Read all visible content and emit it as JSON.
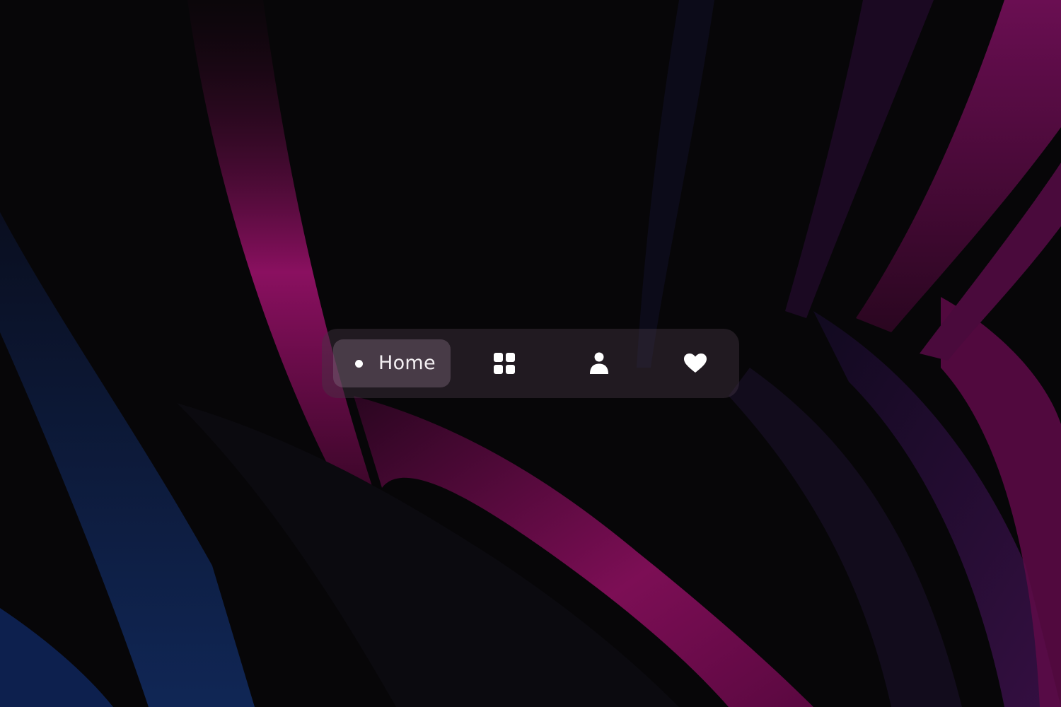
{
  "nav": {
    "home_label": "Home",
    "items": [
      {
        "id": "home",
        "icon": "dot-icon",
        "label": "Home",
        "active": true
      },
      {
        "id": "apps",
        "icon": "grid-icon",
        "active": false
      },
      {
        "id": "profile",
        "icon": "user-icon",
        "active": false
      },
      {
        "id": "favorites",
        "icon": "heart-icon",
        "active": false
      }
    ]
  },
  "colors": {
    "background": "#070608",
    "accent_magenta": "#b0186e",
    "accent_blue": "#0f2a66",
    "icon": "#ffffff"
  }
}
